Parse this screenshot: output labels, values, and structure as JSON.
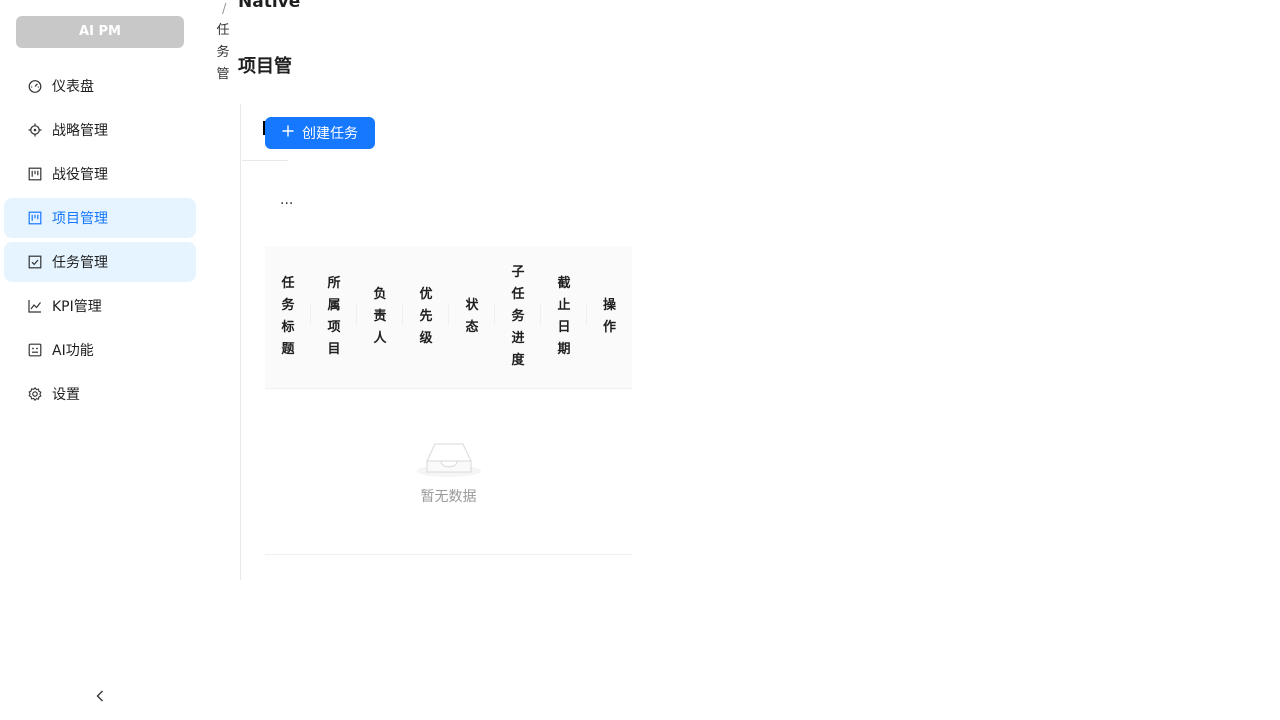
{
  "app": {
    "logo_text": "AI PM"
  },
  "sidebar": {
    "items": [
      {
        "label": "仪表盘",
        "icon": "dashboard-icon"
      },
      {
        "label": "战略管理",
        "icon": "aim-icon"
      },
      {
        "label": "战役管理",
        "icon": "project-board-icon"
      },
      {
        "label": "项目管理",
        "icon": "project-board-icon",
        "state": "active"
      },
      {
        "label": "任务管理",
        "icon": "checkbox-icon",
        "state": "open"
      },
      {
        "label": "KPI管理",
        "icon": "line-chart-icon"
      },
      {
        "label": "AI功能",
        "icon": "robot-icon"
      },
      {
        "label": "设置",
        "icon": "settings-icon"
      }
    ],
    "collapse_icon": "chevron-left-icon"
  },
  "header": {
    "breadcrumb_sep": "/",
    "breadcrumb_top": "Native",
    "breadcrumb_vertical": "任务管",
    "page_title": "项目管"
  },
  "toolbar": {
    "create_label": "创建任务",
    "more_label": "..."
  },
  "table": {
    "columns": [
      "任务标题",
      "所属项目",
      "负责人",
      "优先级",
      "状态",
      "子任务进度",
      "截止日期",
      "操作"
    ],
    "rows": [],
    "empty_text": "暂无数据"
  },
  "colors": {
    "primary": "#1677ff",
    "active_bg": "#e6f4ff",
    "logo_bg": "#c8c8c8"
  }
}
